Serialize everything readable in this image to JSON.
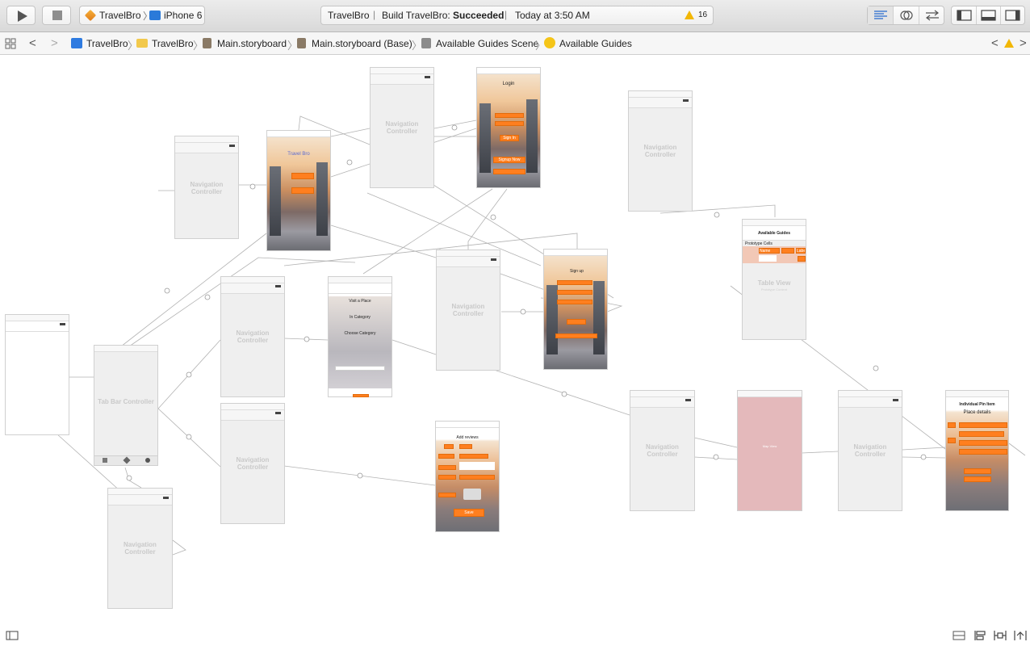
{
  "toolbar": {
    "run_label": "Run",
    "stop_label": "Stop",
    "scheme_name": "TravelBro",
    "device_name": "iPhone 6",
    "status_app": "TravelBro",
    "status_build_prefix": "Build TravelBro:",
    "status_build_result": "Succeeded",
    "status_time": "Today at 3:50 AM",
    "warning_count": "16",
    "warning_color": "#f2b705"
  },
  "pathbar": {
    "crumbs": [
      "TravelBro",
      "TravelBro",
      "Main.storyboard",
      "Main.storyboard (Base)",
      "Available Guides Scene",
      "Available Guides"
    ]
  },
  "scenes": {
    "nav1": {
      "title": "Navigation Controller"
    },
    "nav2": {
      "title": "Navigation Controller"
    },
    "nav3": {
      "title": "Navigation Controller"
    },
    "nav4": {
      "title": "Navigation Controller"
    },
    "nav5": {
      "title": "Navigation Controller"
    },
    "nav6": {
      "title": "Navigation Controller"
    },
    "nav7": {
      "title": "Navigation Controller"
    },
    "nav8": {
      "title": "Navigation Controller"
    },
    "nav9": {
      "title": "Navigation Controller"
    },
    "tabbar": {
      "title": "Tab Bar Controller"
    },
    "home": {
      "app_title": "Travel Bro"
    },
    "login": {
      "heading": "Login",
      "signin": "Sign In",
      "signup": "Signup Now"
    },
    "available": {
      "heading": "Available Guides",
      "prototype": "Prototype Cells",
      "table_title": "Table View",
      "table_sub": "Prototype Content",
      "cell_name": "Name",
      "cell_label": "Label"
    },
    "sign_up": {
      "heading": "Sign up"
    },
    "travel": {
      "line1": "Visit a Place",
      "line2": "In Category",
      "line3": "Choose Category"
    },
    "add_review": {
      "heading": "Add reviews",
      "save": "Save"
    },
    "map": {
      "label": "Map View",
      "color": "#e4b9bb"
    },
    "pin": {
      "heading": "Individual Pin Item",
      "sub": "Place details"
    }
  },
  "colors": {
    "accent_orange": "#ff7f1f",
    "canvas_bg": "#ffffff",
    "scene_bg": "#efefef"
  }
}
